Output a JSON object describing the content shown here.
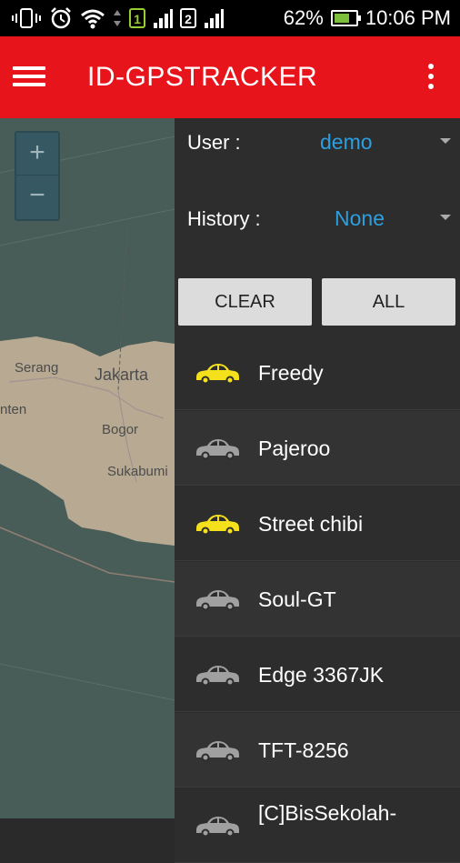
{
  "status_bar": {
    "battery": "62%",
    "time": "10:06 PM",
    "sim1": "1",
    "sim2": "2",
    "icons": [
      "vibrate-icon",
      "alarm-icon",
      "wifi-icon",
      "data-arrows-icon",
      "signal-icon",
      "battery-charging-icon"
    ]
  },
  "app_bar": {
    "title": "ID-GPSTRACKER",
    "menu_icon": "hamburger-icon",
    "overflow_icon": "more-vert-icon"
  },
  "map": {
    "zoom_in": "+",
    "zoom_out": "−",
    "places": [
      "Serang",
      "Jakarta",
      "nten",
      "Bogor",
      "Sukabumi"
    ]
  },
  "drawer": {
    "user_label": "User :",
    "user_value": "demo",
    "history_label": "History :",
    "history_value": "None",
    "clear_label": "CLEAR",
    "all_label": "ALL",
    "vehicles": [
      {
        "name": "Freedy",
        "color": "#f5e11b"
      },
      {
        "name": "Pajeroo",
        "color": "#a0a0a0"
      },
      {
        "name": "Street chibi",
        "color": "#f5e11b"
      },
      {
        "name": "Soul-GT",
        "color": "#a0a0a0"
      },
      {
        "name": "Edge 3367JK",
        "color": "#a0a0a0"
      },
      {
        "name": "TFT-8256",
        "color": "#a0a0a0"
      },
      {
        "name": "[C]BisSekolah-",
        "color": "#a0a0a0"
      }
    ]
  }
}
